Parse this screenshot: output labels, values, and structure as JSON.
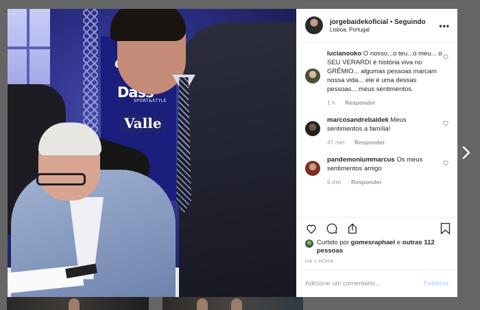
{
  "post": {
    "username": "jorgebaidekoficial",
    "separator": "•",
    "follow_label": "Seguindo",
    "location": "Lisboa, Portugal"
  },
  "photo": {
    "brand_top": "C",
    "brand_dass": "Dass",
    "brand_dass_sub": "SPORT&STYLE",
    "brand_valle": "Valle"
  },
  "comments": [
    {
      "user": "lucianooko",
      "text": "O nosso...o teu...o meu... o SEU VERARDI é história viva no GRÊMIO... algumas pessoas marcam nossa vida... ele é uma dessas pessoas... meus sentimentos.",
      "time": "1 h",
      "reply_label": "Responder"
    },
    {
      "user": "marcosandrebaidek",
      "text": "Meus sentimentos a família!",
      "time": "47 min",
      "reply_label": "Responder"
    },
    {
      "user": "pandemoniummarcus",
      "text": "Os meus sentimentos amigo",
      "time": "5 min",
      "reply_label": "Responder"
    }
  ],
  "likes": {
    "prefix": "Curtido por",
    "user": "gomesraphael",
    "conj": "e",
    "others": "outras 112 pessoas"
  },
  "timestamp": "HÁ 1 HORA",
  "add_comment": {
    "placeholder": "Adicione um comentário...",
    "publish_label": "Publicar"
  },
  "colors": {
    "accent": "#3897f0",
    "publish_disabled": "#b3dbff",
    "meta": "#999999",
    "text": "#262626"
  },
  "icons": [
    "more-icon",
    "heart-icon",
    "comment-icon",
    "share-icon",
    "bookmark-icon",
    "chevron-right-icon"
  ]
}
